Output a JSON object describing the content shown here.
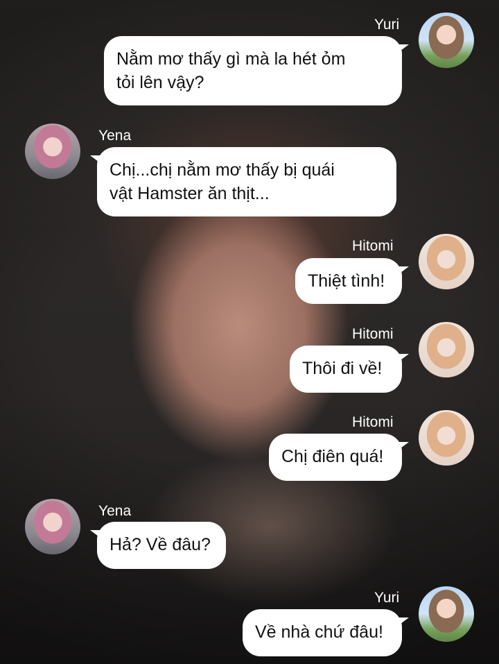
{
  "messages": [
    {
      "sender": "Yuri",
      "side": "right",
      "lines": [
        "Nằm mơ thấy gì mà la hét ỏm",
        "tỏi lên vậy?"
      ]
    },
    {
      "sender": "Yena",
      "side": "left",
      "lines": [
        "Chị...chị nằm mơ thấy bị quái",
        "vật Hamster ăn thịt..."
      ]
    },
    {
      "sender": "Hitomi",
      "side": "right",
      "lines": [
        "Thiệt tình!"
      ]
    },
    {
      "sender": "Hitomi",
      "side": "right",
      "lines": [
        "Thôi đi về!"
      ]
    },
    {
      "sender": "Hitomi",
      "side": "right",
      "lines": [
        "Chị điên quá!"
      ]
    },
    {
      "sender": "Yena",
      "side": "left",
      "lines": [
        "Hả? Về đâu?"
      ]
    },
    {
      "sender": "Yuri",
      "side": "right",
      "lines": [
        "Về nhà chứ đâu!"
      ]
    }
  ],
  "colors": {
    "bubble": "#ffffff",
    "text": "#111111",
    "name": "#ffffff"
  }
}
